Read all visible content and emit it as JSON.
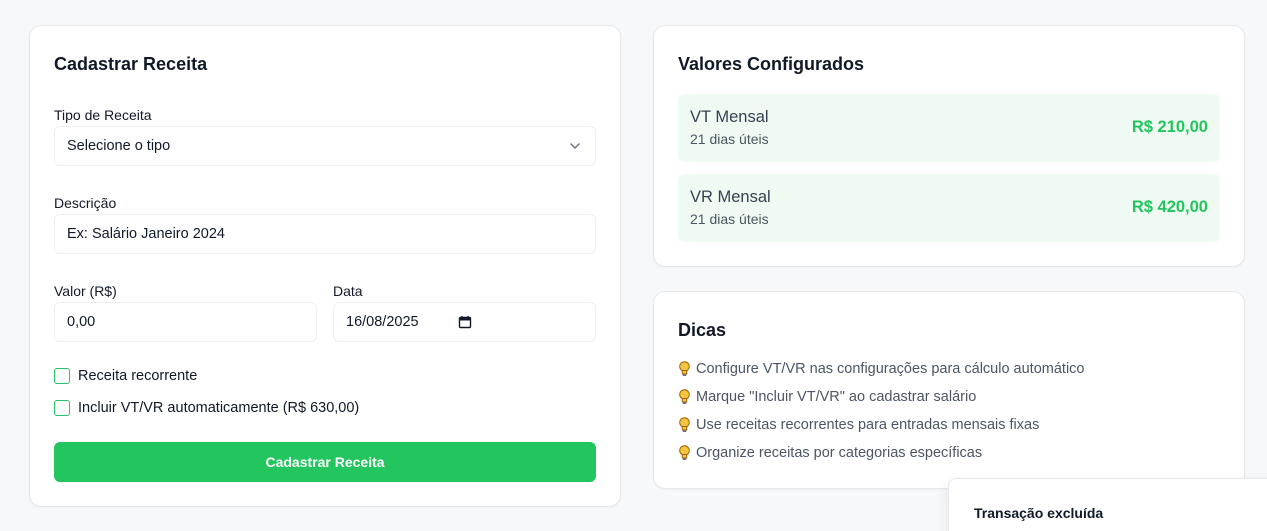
{
  "form": {
    "title": "Cadastrar Receita",
    "type_label": "Tipo de Receita",
    "type_value": "Selecione o tipo",
    "description_label": "Descrição",
    "description_placeholder": "Ex: Salário Janeiro 2024",
    "amount_label": "Valor (R$)",
    "amount_placeholder": "0,00",
    "date_label": "Data",
    "date_value": "16/08/2025",
    "recurring_label": "Receita recorrente",
    "recurring_checked": false,
    "include_vtvr_label": "Incluir VT/VR automaticamente (R$ 630,00)",
    "include_vtvr_checked": false,
    "submit_label": "Cadastrar Receita"
  },
  "values": {
    "title": "Valores Configurados",
    "items": [
      {
        "name": "VT Mensal",
        "sub": "21 dias úteis",
        "amount": "R$ 210,00"
      },
      {
        "name": "VR Mensal",
        "sub": "21 dias úteis",
        "amount": "R$ 420,00"
      }
    ]
  },
  "tips": {
    "title": "Dicas",
    "icon": "lightbulb-icon",
    "items": [
      "Configure VT/VR nas configurações para cálculo automático",
      "Marque \"Incluir VT/VR\" ao cadastrar salário",
      "Use receitas recorrentes para entradas mensais fixas",
      "Organize receitas por categorias específicas"
    ]
  },
  "toast": {
    "title": "Transação excluída"
  },
  "colors": {
    "accent": "#22c55e",
    "value_box_bg": "#effaf3",
    "page_bg": "#f7f8fa"
  }
}
